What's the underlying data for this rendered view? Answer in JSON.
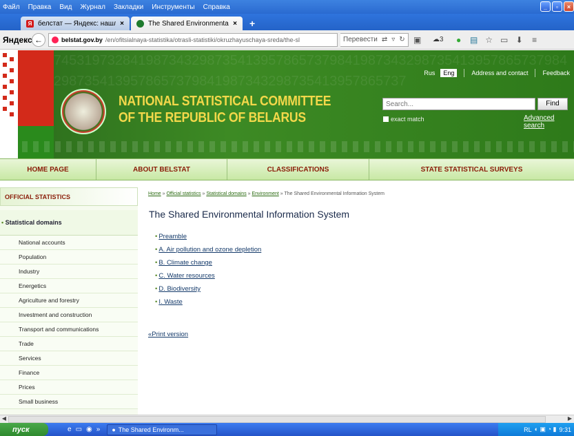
{
  "menubar": {
    "items": [
      "Файл",
      "Правка",
      "Вид",
      "Журнал",
      "Закладки",
      "Инструменты",
      "Справка"
    ]
  },
  "tabs": [
    {
      "title": "белстат — Яндекс: нашлос...",
      "close": "×"
    },
    {
      "title": "The Shared Environmental Inf...",
      "close": "×"
    }
  ],
  "newtab_label": "+",
  "navbar": {
    "logo": "Яндекс",
    "url_host": "belstat.gov.by",
    "url_path": "/en/ofitsialnaya-statistika/otrasli-statistiki/okruzhayuschaya-sreda/the-sl",
    "translate": "Перевести",
    "badge_count": "3"
  },
  "header": {
    "title_line1": "NATIONAL STATISTICAL COMMITTEE",
    "title_line2": "OF THE REPUBLIC OF BELARUS",
    "lang_rus": "Rus",
    "lang_eng": "Eng",
    "address_link": "Address and contact",
    "feedback_link": "Feedback",
    "search_placeholder": "Search...",
    "find_button": "Find",
    "exact_match": "exact match",
    "advanced_search": "Advanced search",
    "digits": "9813932745319732841987343298735413957865737984198734329873541395786573798419873432987354139578657379841987343298735413957865737"
  },
  "mainnav": [
    "HOME PAGE",
    "ABOUT BELSTAT",
    "CLASSIFICATIONS",
    "STATE STATISTICAL SURVEYS"
  ],
  "sidebar": {
    "head": "OFFICIAL STATISTICS",
    "sub": "Statistical domains",
    "items": [
      "National accounts",
      "Population",
      "Industry",
      "Energetics",
      "Agriculture and forestry",
      "Investment and construction",
      "Transport and communications",
      "Trade",
      "Services",
      "Finance",
      "Prices",
      "Small business"
    ]
  },
  "content": {
    "breadcrumb": [
      "Home",
      "Official statistics",
      "Statistical domains",
      "Environment",
      "The Shared Environmental Information System"
    ],
    "breadcrumb_sep": " » ",
    "title": "The Shared Environmental Information System",
    "links": [
      "Preamble",
      "A. Air pollution and ozone depletion",
      "B. Climate change",
      "C. Water resources",
      "D. Biodiversity",
      "I. Waste"
    ],
    "print": "«Print version"
  },
  "taskbar": {
    "start": "пуск",
    "task": "The Shared Environm...",
    "tray_lang": "RL",
    "clock": "9:31"
  }
}
